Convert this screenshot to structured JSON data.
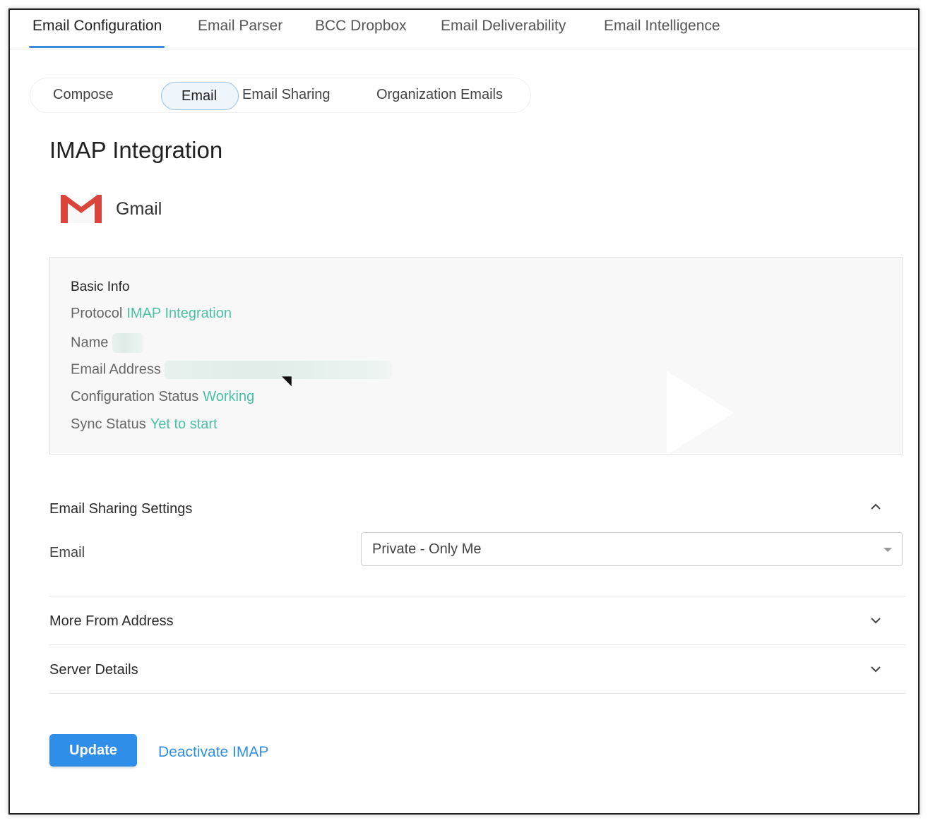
{
  "top_tabs": [
    {
      "label": "Email Configuration",
      "active": true
    },
    {
      "label": "Email Parser"
    },
    {
      "label": "BCC Dropbox"
    },
    {
      "label": "Email Deliverability"
    },
    {
      "label": "Email Intelligence"
    }
  ],
  "sub_tabs": [
    {
      "label": "Compose"
    },
    {
      "label": "Email",
      "active": true
    },
    {
      "label": "Email Sharing"
    },
    {
      "label": "Organization Emails"
    }
  ],
  "page_title": "IMAP Integration",
  "provider": {
    "name": "Gmail",
    "icon": "gmail-logo-icon"
  },
  "basic_info": {
    "heading": "Basic Info",
    "protocol_label": "Protocol",
    "protocol_value": "IMAP Integration",
    "name_label": "Name",
    "email_label": "Email Address",
    "config_status_label": "Configuration Status",
    "config_status_value": "Working",
    "sync_status_label": "Sync Status",
    "sync_status_value": "Yet to start"
  },
  "sharing": {
    "title": "Email Sharing Settings",
    "field_label": "Email",
    "selected": "Private - Only Me"
  },
  "sections": {
    "more_from": "More From Address",
    "server_details": "Server Details"
  },
  "actions": {
    "update": "Update",
    "deactivate": "Deactivate IMAP"
  },
  "colors": {
    "accent": "#2f8fe8",
    "status_green": "#4cc0a5",
    "gmail_red": "#d9453a"
  }
}
